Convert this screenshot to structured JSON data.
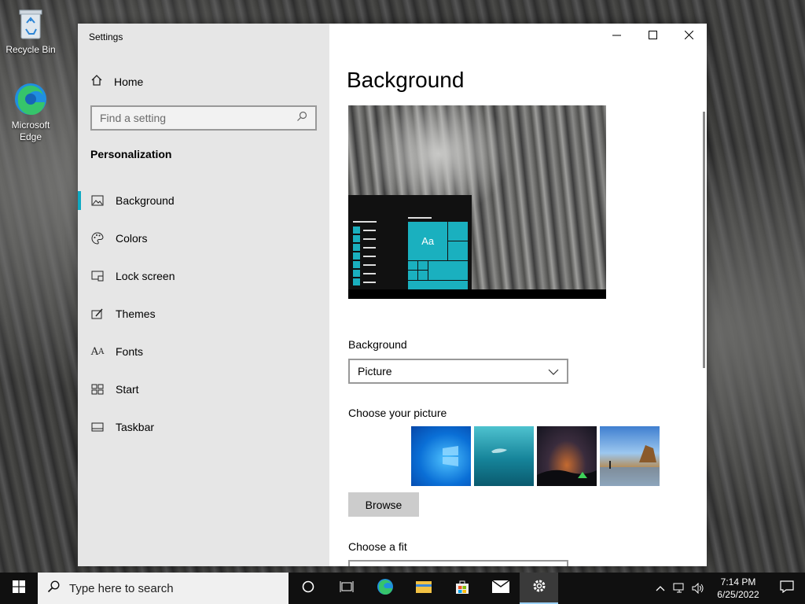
{
  "desktop": {
    "icons": [
      {
        "label": "Recycle Bin"
      },
      {
        "label": "Microsoft Edge"
      }
    ]
  },
  "window": {
    "title": "Settings",
    "buttons": {
      "minimize": "minimize-icon",
      "maximize": "maximize-icon",
      "close": "close-icon"
    }
  },
  "sidebar": {
    "home": "Home",
    "search_placeholder": "Find a setting",
    "section": "Personalization",
    "items": [
      {
        "label": "Background",
        "icon": "image-icon",
        "active": true
      },
      {
        "label": "Colors",
        "icon": "palette-icon"
      },
      {
        "label": "Lock screen",
        "icon": "lock-screen-icon"
      },
      {
        "label": "Themes",
        "icon": "themes-icon"
      },
      {
        "label": "Fonts",
        "icon": "fonts-icon"
      },
      {
        "label": "Start",
        "icon": "start-icon"
      },
      {
        "label": "Taskbar",
        "icon": "taskbar-icon"
      }
    ]
  },
  "main": {
    "title": "Background",
    "preview_tile_text": "Aa",
    "background_label": "Background",
    "background_value": "Picture",
    "choose_picture_label": "Choose your picture",
    "browse_label": "Browse",
    "choose_fit_label": "Choose a fit"
  },
  "taskbar": {
    "search_placeholder": "Type here to search",
    "apps": [
      "cortana-icon",
      "task-view-icon",
      "edge-icon",
      "file-explorer-icon",
      "store-icon",
      "mail-icon",
      "settings-icon"
    ],
    "time": "7:14 PM",
    "date": "6/25/2022"
  },
  "colors": {
    "accent": "#0fa9c2",
    "tile": "#1ab0bf"
  }
}
